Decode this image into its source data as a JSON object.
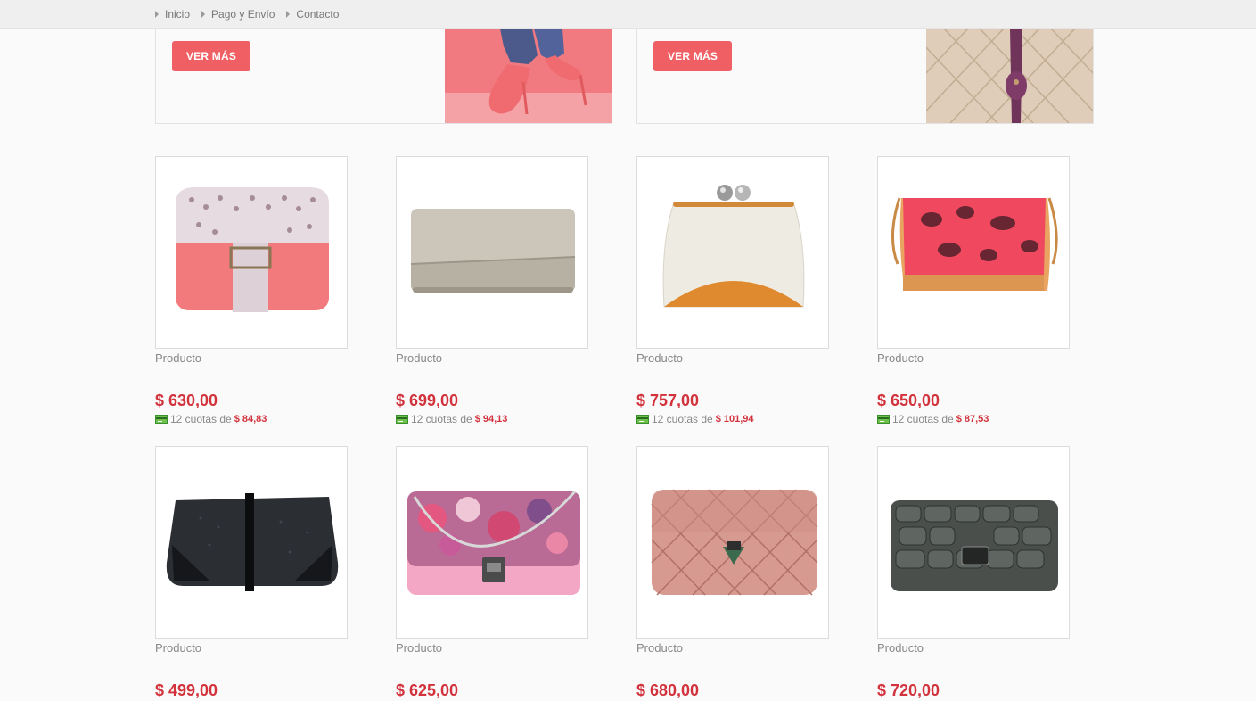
{
  "nav": {
    "items": [
      {
        "label": "Inicio"
      },
      {
        "label": "Pago y Envío"
      },
      {
        "label": "Contacto"
      }
    ]
  },
  "banners": [
    {
      "button_label": "VER MÁS",
      "image": "woman-legs-pink-heels"
    },
    {
      "button_label": "VER MÁS",
      "image": "quilted-cream-bag-purple-zipper"
    }
  ],
  "products": [
    {
      "name": "Producto",
      "price": "$ 630,00",
      "quota_text": "12 cuotas de",
      "quota_amount": "$ 84,83",
      "image": "pink-dotted-flap-bag"
    },
    {
      "name": "Producto",
      "price": "$ 699,00",
      "quota_text": "12 cuotas de",
      "quota_amount": "$ 94,13",
      "image": "grey-snakeskin-clutch"
    },
    {
      "name": "Producto",
      "price": "$ 757,00",
      "quota_text": "12 cuotas de",
      "quota_amount": "$ 101,94",
      "image": "cream-orange-kisslock-bag"
    },
    {
      "name": "Producto",
      "price": "$ 650,00",
      "quota_text": "12 cuotas de",
      "quota_amount": "$ 87,53",
      "image": "pink-python-shoulder-bag"
    },
    {
      "name": "Producto",
      "price": "$ 499,00",
      "quota_text": "",
      "quota_amount": "",
      "image": "black-patent-clutch"
    },
    {
      "name": "Producto",
      "price": "$ 625,00",
      "quota_text": "",
      "quota_amount": "",
      "image": "floral-pink-chain-bag"
    },
    {
      "name": "Producto",
      "price": "$ 680,00",
      "quota_text": "",
      "quota_amount": "",
      "image": "quilted-pink-bag"
    },
    {
      "name": "Producto",
      "price": "$ 720,00",
      "quota_text": "",
      "quota_amount": "",
      "image": "dark-croc-bag"
    }
  ],
  "colors": {
    "accent": "#ef5f63",
    "price": "#d2323c",
    "card_icon": "#6cc24a"
  }
}
